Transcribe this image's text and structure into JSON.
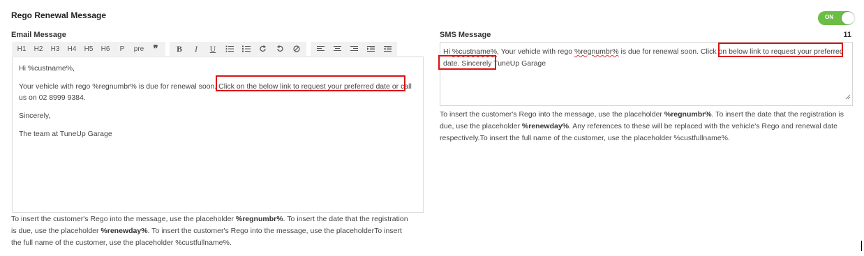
{
  "panel": {
    "title": "Rego Renewal Message",
    "toggle_label": "ON",
    "toggle_state": "on",
    "toggle_color": "#6cbd45"
  },
  "email": {
    "label": "Email Message",
    "toolbar": {
      "headings": [
        "H1",
        "H2",
        "H3",
        "H4",
        "H5",
        "H6",
        "P",
        "pre"
      ],
      "quote_icon": "quote-icon",
      "format": [
        "B",
        "I",
        "U"
      ],
      "list_icons": [
        "bulleted-list-icon",
        "numbered-list-icon",
        "redo-icon",
        "undo-icon",
        "clear-format-icon"
      ],
      "align_icons": [
        "align-left-icon",
        "align-center-icon",
        "align-right-icon",
        "indent-icon",
        "outdent-icon"
      ]
    },
    "body": {
      "greeting": "Hi %custname%,",
      "line1": "Your vehicle with rego %regnumbr% is due for renewal soon. Click on the below link to request your preferred date or call us on 02 8999 9384.",
      "closing": "Sincerely,",
      "signature": "The team at TuneUp Garage"
    },
    "help": {
      "t1": "To insert the customer's Rego into the message, use the placeholder ",
      "p1": "%regnumbr%",
      "t2": ". To insert the date that the registration is due, use the placeholder ",
      "p2": "%renewday%",
      "t3": ". To insert the customer's Rego into the message, use the placeholderTo insert the full name of the customer, use the placeholder %custfullname%."
    }
  },
  "sms": {
    "label": "SMS Message",
    "count": "11",
    "text_pre": "Hi ",
    "text_custname": "%custname%",
    "text_mid": ", Your vehicle with rego ",
    "text_regnumbr": "%regnumbr%",
    "text_post": " is due for renewal soon. Click on below link to request your preferred date. Sincerely TuneUp Garage",
    "help": {
      "t1": "To insert the customer's Rego into the message, use the placeholder ",
      "p1": "%regnumbr%",
      "t2": ". To insert the date that the registration is due, use the placeholder ",
      "p2": "%renewday%",
      "t3": ". Any references to these will be replaced with the vehicle's Rego and renewal date respectively.To insert the full name of the customer, use the placeholder %custfullname%."
    }
  },
  "colors": {
    "highlight": "#dd1111"
  }
}
